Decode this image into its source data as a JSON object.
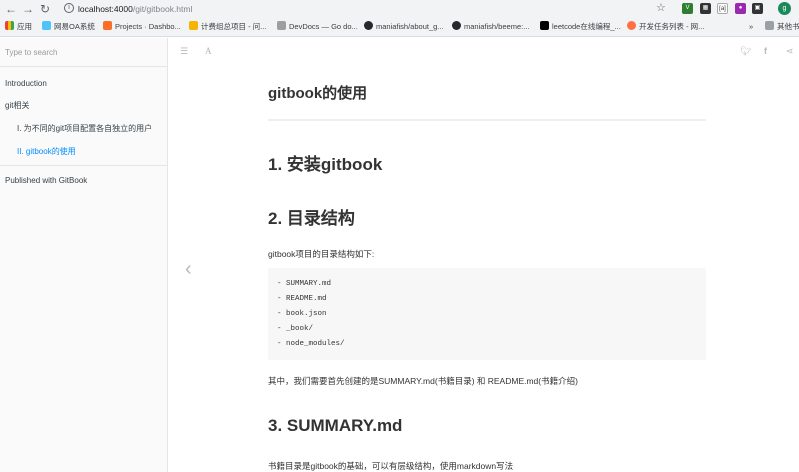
{
  "browser": {
    "url_host": "localhost:4000",
    "url_path": "/git/gitbook.html",
    "bookmarks": [
      {
        "label": "应用",
        "color": "#ea4335"
      },
      {
        "label": "网易OA系统",
        "color": "#4fc3f7"
      },
      {
        "label": "Projects · Dashbo...",
        "color": "#fc6d26"
      },
      {
        "label": "计费组总项目 - 问...",
        "color": "#f4b400"
      },
      {
        "label": "DevDocs — Go do...",
        "color": "#9e9e9e"
      },
      {
        "label": "maniafish/about_g...",
        "color": "#24292e"
      },
      {
        "label": "maniafish/beeme:...",
        "color": "#24292e"
      },
      {
        "label": "leetcode在线编程_...",
        "color": "#000000"
      },
      {
        "label": "开发任务列表 - 网...",
        "color": "#ff7043"
      }
    ],
    "bookmarks_more": "»",
    "other_bookmarks": "其他书",
    "profile_initial": "g"
  },
  "sidebar": {
    "search_placeholder": "Type to search",
    "items": [
      {
        "label": "Introduction"
      },
      {
        "label": "git相关"
      },
      {
        "label": "I. 为不同的git项目配置各自独立的用户"
      },
      {
        "label": "II. gitbook的使用"
      }
    ],
    "published": "Published with GitBook"
  },
  "page": {
    "title": "gitbook的使用",
    "section1": "1. 安装gitbook",
    "section2": "2. 目录结构",
    "intro": "gitbook项目的目录结构如下:",
    "code_lines": [
      "- SUMMARY.md",
      "- README.md",
      "- book.json",
      "- _book/",
      "- node_modules/"
    ],
    "note": "其中，我们需要首先创建的是SUMMARY.md(书籍目录) 和 README.md(书籍介绍)",
    "section3": "3. SUMMARY.md",
    "summary_text": "书籍目录是gitbook的基础，可以有层级结构，使用markdown写法"
  },
  "colors": {
    "accent": "#008cff",
    "sidebar_bg": "#fafafa"
  }
}
